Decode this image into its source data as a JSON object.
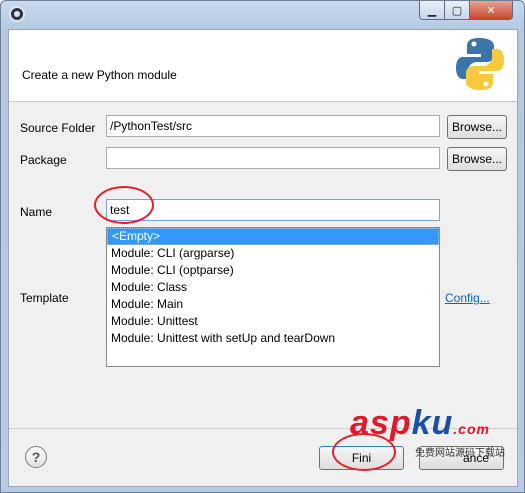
{
  "banner": {
    "title": "Create a new Python module"
  },
  "form": {
    "source_folder": {
      "label": "Source Folder",
      "value": "/PythonTest/src",
      "browse_label": "Browse..."
    },
    "package": {
      "label": "Package",
      "value": "",
      "browse_label": "Browse..."
    },
    "name": {
      "label": "Name",
      "value": "test"
    },
    "template": {
      "label": "Template",
      "options": [
        "<Empty>",
        "Module: CLI (argparse)",
        "Module: CLI (optparse)",
        "Module: Class",
        "Module: Main",
        "Module: Unittest",
        "Module: Unittest with setUp and tearDown"
      ],
      "selected_index": 0,
      "config_link": "Config..."
    }
  },
  "footer": {
    "help_glyph": "?",
    "finish_label": "Fini",
    "cancel_label": "ance"
  },
  "watermark": {
    "part1": "asp",
    "part2": "ku",
    "suffix": ".com",
    "sub": "免费网站源码下载站"
  },
  "colors": {
    "selection": "#3399ff",
    "annotation": "#e0202a",
    "link": "#0066cc"
  }
}
